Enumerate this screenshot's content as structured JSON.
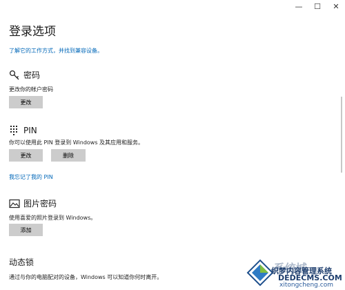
{
  "window": {
    "minimize_glyph": "—",
    "maximize_glyph": "☐",
    "close_glyph": "✕"
  },
  "page": {
    "title": "登录选项",
    "learn_link": "了解它的工作方式，并找到兼容设备。"
  },
  "password": {
    "icon": "key-icon",
    "heading": "密码",
    "description": "更改你的帐户密码",
    "change_label": "更改"
  },
  "pin": {
    "icon": "pin-keypad-icon",
    "heading": "PIN",
    "description": "你可以使用此 PIN 登录到 Windows 及其应用和服务。",
    "change_label": "更改",
    "remove_label": "删除",
    "forgot_link": "我忘记了我的 PIN"
  },
  "picture_password": {
    "icon": "picture-icon",
    "heading": "图片密码",
    "description": "使用喜爱的照片登录到 Windows。",
    "add_label": "添加"
  },
  "dynamic_lock": {
    "heading": "动态锁",
    "description": "通过与你的电脑配对的设备，Windows 可以知道你何时离开。"
  },
  "watermark": {
    "line1": "织梦内容管理系统",
    "line2": "DEDECMS.COM",
    "line3": "xitongcheng.com",
    "logo_text": "系统城"
  },
  "colors": {
    "accent": "#0067b8",
    "button": "#cccccc"
  }
}
